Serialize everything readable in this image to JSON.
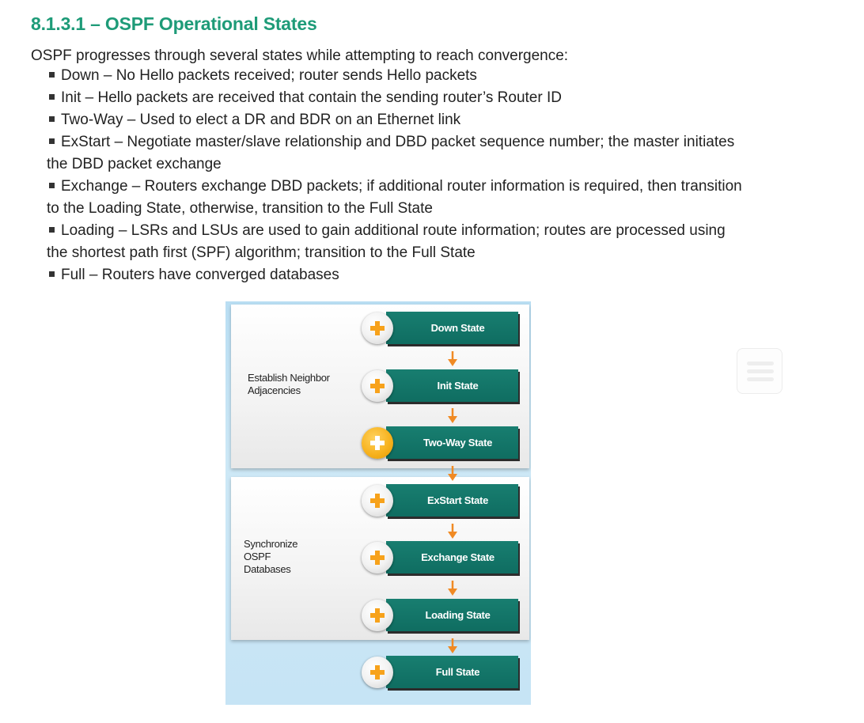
{
  "header": {
    "title": "8.1.3.1 – OSPF Operational States"
  },
  "intro": "OSPF progresses through several states while attempting to reach convergence:",
  "states_list": [
    "Down – No Hello packets received; router sends Hello packets",
    "Init – Hello packets are received that contain the sending router’s Router ID",
    "Two-Way – Used to elect a DR and BDR on an Ethernet link",
    "ExStart – Negotiate master/slave relationship and DBD packet sequence number; the master initiates the DBD packet exchange",
    "Exchange – Routers exchange DBD packets; if additional router information is required, then transition to the Loading State, otherwise, transition to the Full State",
    "Loading – LSRs and LSUs are used to gain additional route information; routes are processed using the shortest path first (SPF) algorithm; transition to the Full State",
    "Full – Routers have converged databases"
  ],
  "diagram": {
    "groups": {
      "neighbor": "Establish Neighbor Adjacencies",
      "sync": "Synchronize OSPF Databases"
    },
    "nodes": [
      {
        "label": "Down State",
        "active": false
      },
      {
        "label": "Init State",
        "active": false
      },
      {
        "label": "Two-Way State",
        "active": true
      },
      {
        "label": "ExStart State",
        "active": false
      },
      {
        "label": "Exchange State",
        "active": false
      },
      {
        "label": "Loading State",
        "active": false
      },
      {
        "label": "Full State",
        "active": false
      }
    ],
    "icons": {
      "expand": "plus-icon",
      "flow": "arrow-down-icon"
    },
    "colors": {
      "state_box": "#127466",
      "plus_accent": "#f7a21b",
      "arrow": "#f08a24",
      "background": "#c6e4f5"
    }
  },
  "side_icon": "list-icon",
  "colors": {
    "title": "#1e9b78"
  }
}
